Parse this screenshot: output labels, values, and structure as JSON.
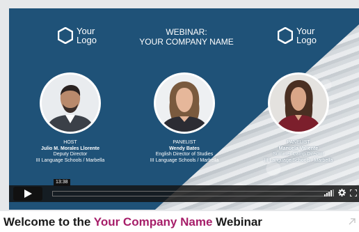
{
  "colors": {
    "panel_bg": "#1f5278",
    "accent": "#a61e69",
    "control_bar": "#111111"
  },
  "banner": {
    "logo_left": {
      "line1": "Your",
      "line2": "Logo",
      "icon": "hexagon-logo-icon"
    },
    "logo_right": {
      "line1": "Your",
      "line2": "Logo",
      "icon": "hexagon-logo-icon"
    },
    "heading_line1": "WEBINAR:",
    "heading_line2": "YOUR COMPANY NAME"
  },
  "people": [
    {
      "role": "HOST",
      "name": "Julio M. Morales Llorente",
      "title": "Deputy Director",
      "org": "III Language Schools / Marbella"
    },
    {
      "role": "PANELIST",
      "name": "Wendy Bates",
      "title": "English Director of Studies",
      "org": "III Language Schools / Marbella"
    },
    {
      "role": "PANELIST",
      "name": "Manuela Valiente",
      "title": "Summer Camp Director",
      "org": "III Language Schools / Marbella"
    }
  ],
  "player": {
    "time": "13:38",
    "progress": 0.0,
    "icons": {
      "play": "play-icon",
      "volume": "volume-bars-icon",
      "settings": "gear-icon",
      "fullscreen": "fullscreen-icon"
    }
  },
  "page": {
    "title_prefix": "Welcome to the",
    "title_accent": "Your Company Name",
    "title_suffix": "Webinar",
    "corner_icon": "share-arrow-icon"
  }
}
